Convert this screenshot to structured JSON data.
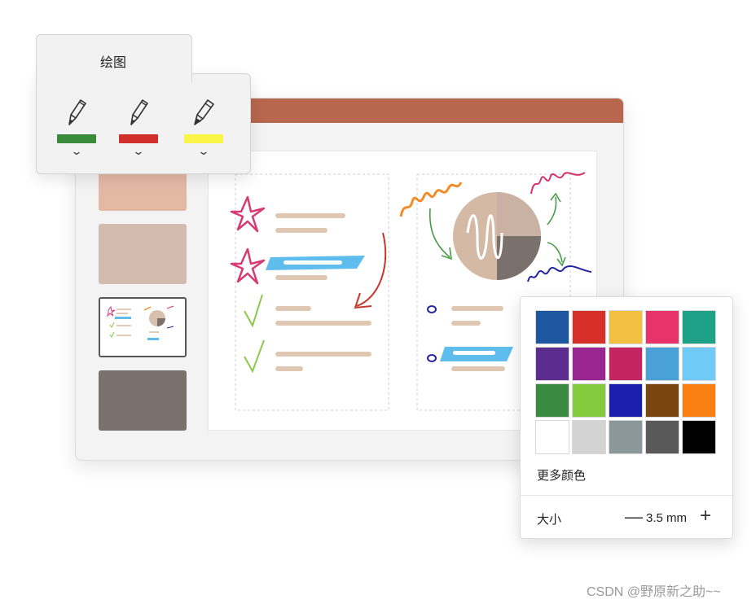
{
  "draw_panel": {
    "title": "绘图",
    "pens": [
      {
        "color": "#3a8a3c",
        "icon": "pen-icon"
      },
      {
        "color": "#d12f2a",
        "icon": "pen-icon"
      },
      {
        "color": "#fbf54a",
        "icon": "highlighter-icon"
      }
    ],
    "chevron": "⌄"
  },
  "color_popup": {
    "colors": [
      "#1e56a0",
      "#d73029",
      "#f2c144",
      "#e8336a",
      "#1ea287",
      "#5c2d8f",
      "#9b2691",
      "#c22560",
      "#4aa1d8",
      "#6fcaf6",
      "#3b8a41",
      "#84cc3d",
      "#1b1dad",
      "#7b4512",
      "#fb8014",
      "#ffffff",
      "#d3d3d3",
      "#8a989c",
      "#595959",
      "#000000"
    ],
    "more_colors": "更多颜色",
    "size_label": "大小",
    "size_value": "3.5 mm",
    "minus": "—",
    "plus": "+"
  },
  "window": {
    "title_bar_color": "#b9664f",
    "thumbnail_colors": [
      "#e4b9a4",
      "#d4bbb0",
      "#ffffff",
      "#7a706c"
    ]
  },
  "watermark": "CSDN @野原新之助~~"
}
